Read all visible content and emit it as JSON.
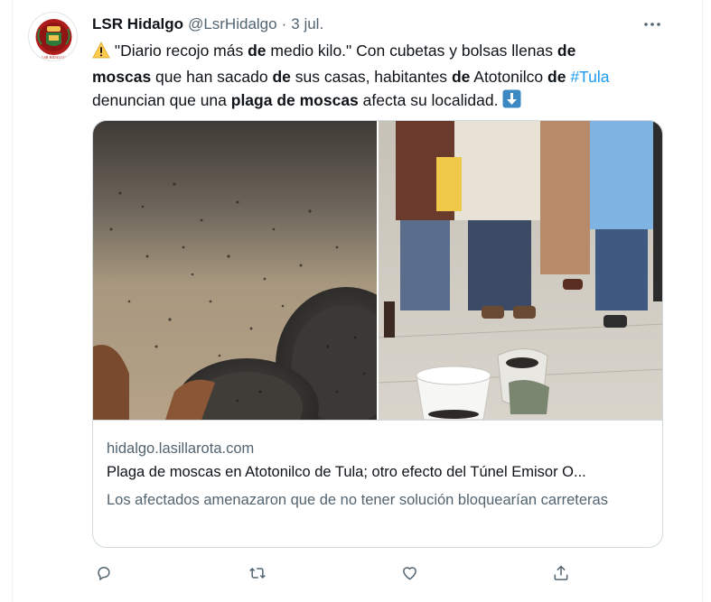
{
  "tweet": {
    "author_name": "LSR Hidalgo",
    "handle": "@LsrHidalgo",
    "separator": "·",
    "time": "3 jul.",
    "text_lines": [
      [
        {
          "t": " \"Diario recojo más ",
          "s": "n"
        },
        {
          "t": "de",
          "s": "b"
        },
        {
          "t": " medio kilo.\" Con cubetas y bolsas llenas ",
          "s": "n"
        },
        {
          "t": "de",
          "s": "b"
        }
      ],
      [
        {
          "t": "moscas",
          "s": "b"
        },
        {
          "t": " que han sacado ",
          "s": "n"
        },
        {
          "t": "de",
          "s": "b"
        },
        {
          "t": " sus casas, habitantes ",
          "s": "n"
        },
        {
          "t": "de",
          "s": "b"
        },
        {
          "t": " Atotonilco ",
          "s": "n"
        },
        {
          "t": "de",
          "s": "b"
        },
        {
          "t": " ",
          "s": "n"
        },
        {
          "t": "#Tula",
          "s": "h"
        }
      ],
      [
        {
          "t": "denuncian que una ",
          "s": "n"
        },
        {
          "t": "plaga de moscas",
          "s": "b"
        },
        {
          "t": " afecta su localidad. ",
          "s": "n"
        }
      ]
    ],
    "icons": {
      "warning": "warning-emoji-icon",
      "down_arrow": "down-arrow-emoji-icon",
      "more": "more-options-icon"
    }
  },
  "card": {
    "domain": "hidalgo.lasillarota.com",
    "title": "Plaga de moscas en Atotonilco de Tula; otro efecto del Túnel Emisor O...",
    "description": "Los afectados amenazaron que de no tener solución bloquearían carreteras"
  },
  "actions": [
    {
      "name": "reply",
      "icon": "reply-icon"
    },
    {
      "name": "retweet",
      "icon": "retweet-icon"
    },
    {
      "name": "like",
      "icon": "like-icon"
    },
    {
      "name": "share",
      "icon": "share-icon"
    }
  ],
  "colors": {
    "text": "#0f1419",
    "secondary": "#536471",
    "link": "#1d9bf0",
    "border": "#cfd9de",
    "avatar_red": "#b01c1c"
  }
}
